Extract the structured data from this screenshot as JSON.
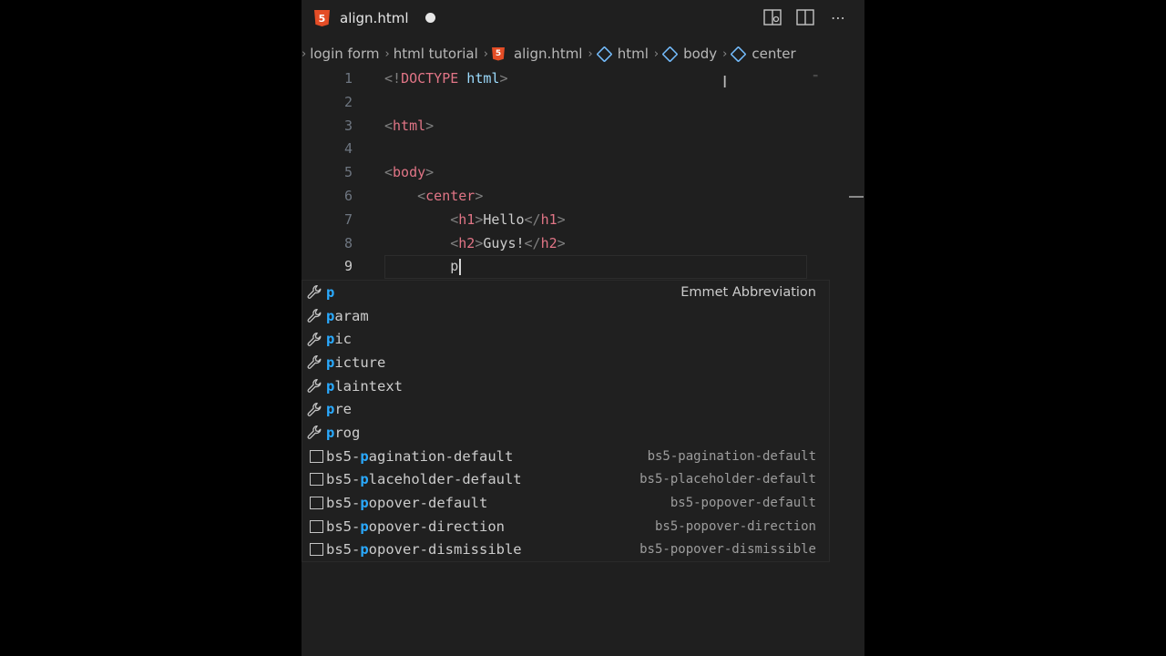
{
  "tab": {
    "filename": "align.html",
    "file_icon": "html5-icon",
    "dirty": true
  },
  "toolbar": {
    "icons": [
      "open-preview-icon",
      "split-editor-icon",
      "more-actions-icon"
    ]
  },
  "breadcrumbs": [
    "login form",
    "html tutorial",
    "align.html",
    "html",
    "body",
    "center"
  ],
  "code": {
    "lines": [
      {
        "num": "1",
        "text": "<!DOCTYPE html>"
      },
      {
        "num": "2",
        "text": ""
      },
      {
        "num": "3",
        "text": "<html>"
      },
      {
        "num": "4",
        "text": ""
      },
      {
        "num": "5",
        "text": "<body>"
      },
      {
        "num": "6",
        "text": "    <center>"
      },
      {
        "num": "7",
        "text": "        <h1>Hello</h1>"
      },
      {
        "num": "8",
        "text": "        <h2>Guys!</h2>"
      },
      {
        "num": "9",
        "text": "        p"
      }
    ]
  },
  "suggestions": [
    {
      "label": "p",
      "detail": "Emmet Abbreviation",
      "kind": "wrench-icon"
    },
    {
      "label": "param",
      "detail": "",
      "kind": "wrench-icon"
    },
    {
      "label": "pic",
      "detail": "",
      "kind": "wrench-icon"
    },
    {
      "label": "picture",
      "detail": "",
      "kind": "wrench-icon"
    },
    {
      "label": "plaintext",
      "detail": "",
      "kind": "wrench-icon"
    },
    {
      "label": "pre",
      "detail": "",
      "kind": "wrench-icon"
    },
    {
      "label": "prog",
      "detail": "",
      "kind": "wrench-icon"
    },
    {
      "label": "bs5-pagination-default",
      "detail": "bs5-pagination-default",
      "kind": "snippet-icon"
    },
    {
      "label": "bs5-placeholder-default",
      "detail": "bs5-placeholder-default",
      "kind": "snippet-icon"
    },
    {
      "label": "bs5-popover-default",
      "detail": "bs5-popover-default",
      "kind": "snippet-icon"
    },
    {
      "label": "bs5-popover-direction",
      "detail": "bs5-popover-direction",
      "kind": "snippet-icon"
    },
    {
      "label": "bs5-popover-dismissible",
      "detail": "bs5-popover-dismissible",
      "kind": "snippet-icon"
    }
  ],
  "colors": {
    "editor_bg": "#1f1f1f",
    "tag": "#e17586",
    "match_highlight": "#2aaaff"
  }
}
